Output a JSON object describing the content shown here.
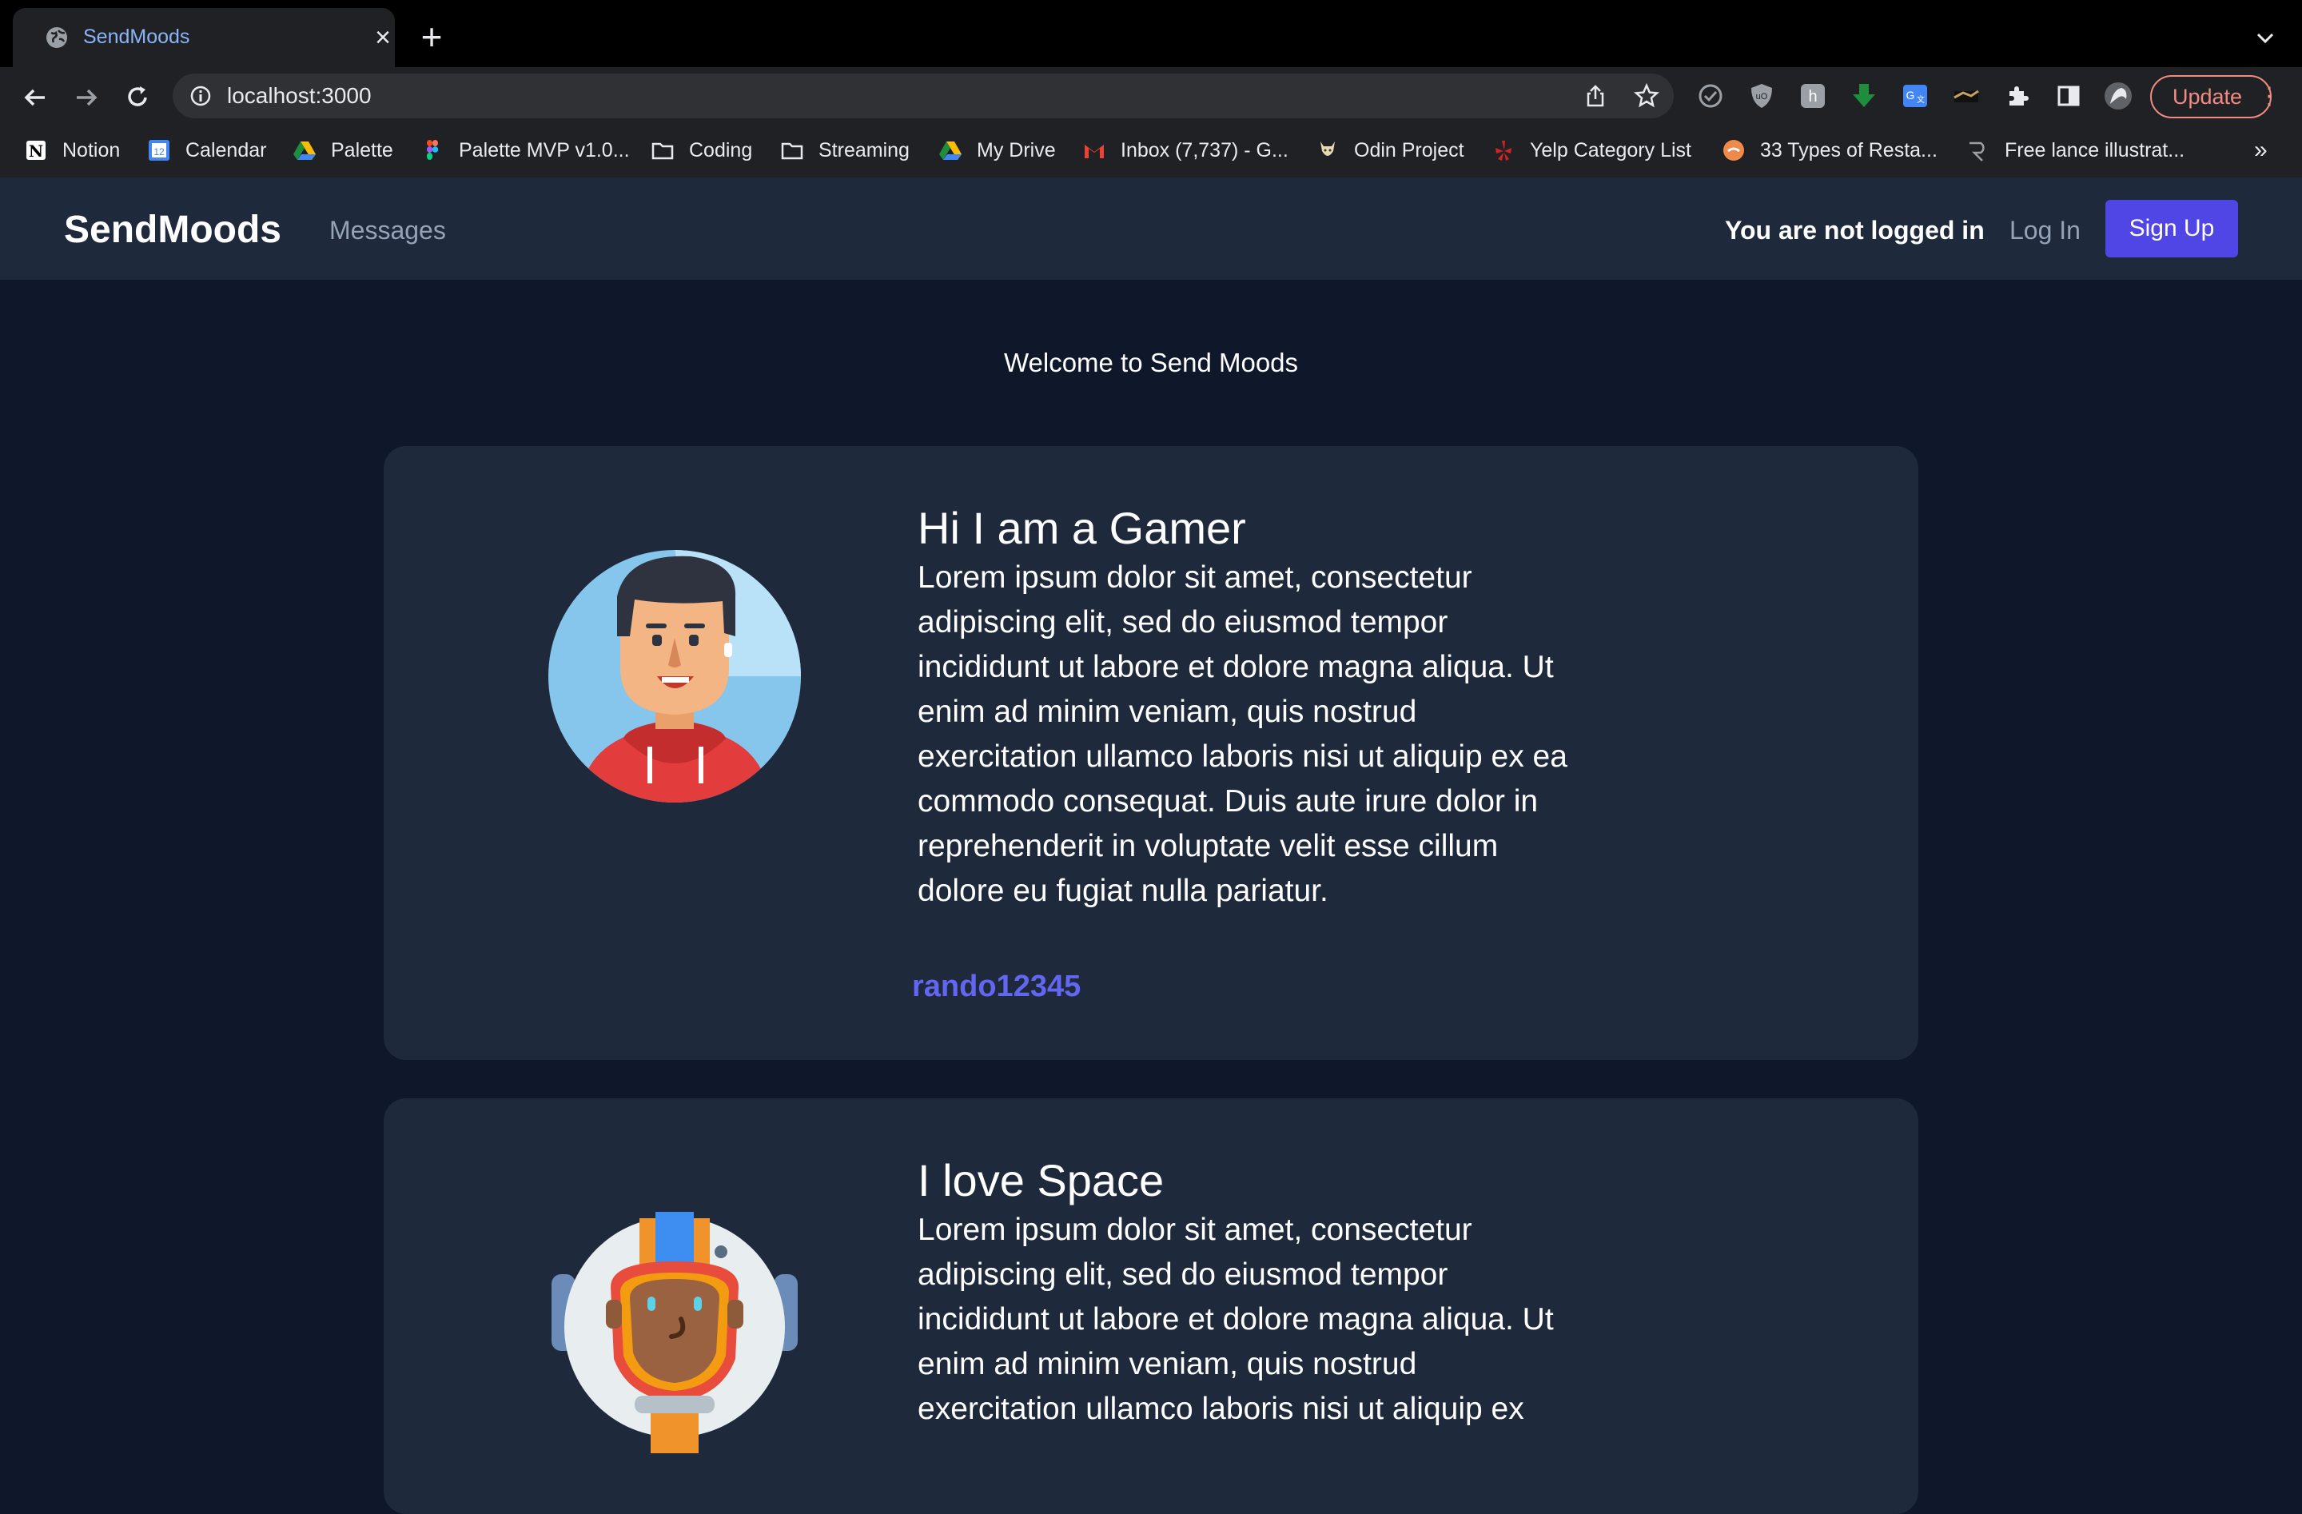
{
  "browser": {
    "tab_title": "SendMoods",
    "new_tab_symbol": "+",
    "close_symbol": "×",
    "url": "localhost:3000",
    "update_label": "Update",
    "bookmarks": [
      {
        "label": "Notion",
        "icon": "notion-icon"
      },
      {
        "label": "Calendar",
        "icon": "calendar-icon"
      },
      {
        "label": "Palette",
        "icon": "google-drive-icon"
      },
      {
        "label": "Palette MVP v1.0...",
        "icon": "figma-icon"
      },
      {
        "label": "Coding",
        "icon": "folder-icon"
      },
      {
        "label": "Streaming",
        "icon": "folder-icon"
      },
      {
        "label": "My Drive",
        "icon": "google-drive-icon"
      },
      {
        "label": "Inbox (7,737) - G...",
        "icon": "gmail-icon"
      },
      {
        "label": "Odin Project",
        "icon": "odin-icon"
      },
      {
        "label": "Yelp Category List",
        "icon": "yelp-icon"
      },
      {
        "label": "33 Types of Resta...",
        "icon": "site-icon"
      },
      {
        "label": "Free lance illustrat...",
        "icon": "site-icon"
      }
    ],
    "bookmarks_more": "»"
  },
  "app": {
    "brand": "SendMoods",
    "nav_messages": "Messages",
    "status": "You are not logged in",
    "login": "Log In",
    "signup": "Sign Up",
    "accent_color": "#4f46e5"
  },
  "main": {
    "welcome": "Welcome to Send Moods",
    "posts": [
      {
        "title": "Hi I am a Gamer",
        "body": "Lorem ipsum dolor sit amet, consectetur adipiscing elit, sed do eiusmod tempor incididunt ut labore et dolore magna aliqua. Ut enim ad minim veniam, quis nostrud exercitation ullamco laboris nisi ut aliquip ex ea commodo consequat. Duis aute irure dolor in reprehenderit in voluptate velit esse cillum dolore eu fugiat nulla pariatur.",
        "username": "rando12345",
        "avatar": "gamer-avatar-icon"
      },
      {
        "title": "I love Space",
        "body": "Lorem ipsum dolor sit amet, consectetur adipiscing elit, sed do eiusmod tempor incididunt ut labore et dolore magna aliqua. Ut enim ad minim veniam, quis nostrud exercitation ullamco laboris nisi ut aliquip ex",
        "avatar": "astronaut-avatar-icon"
      }
    ]
  }
}
